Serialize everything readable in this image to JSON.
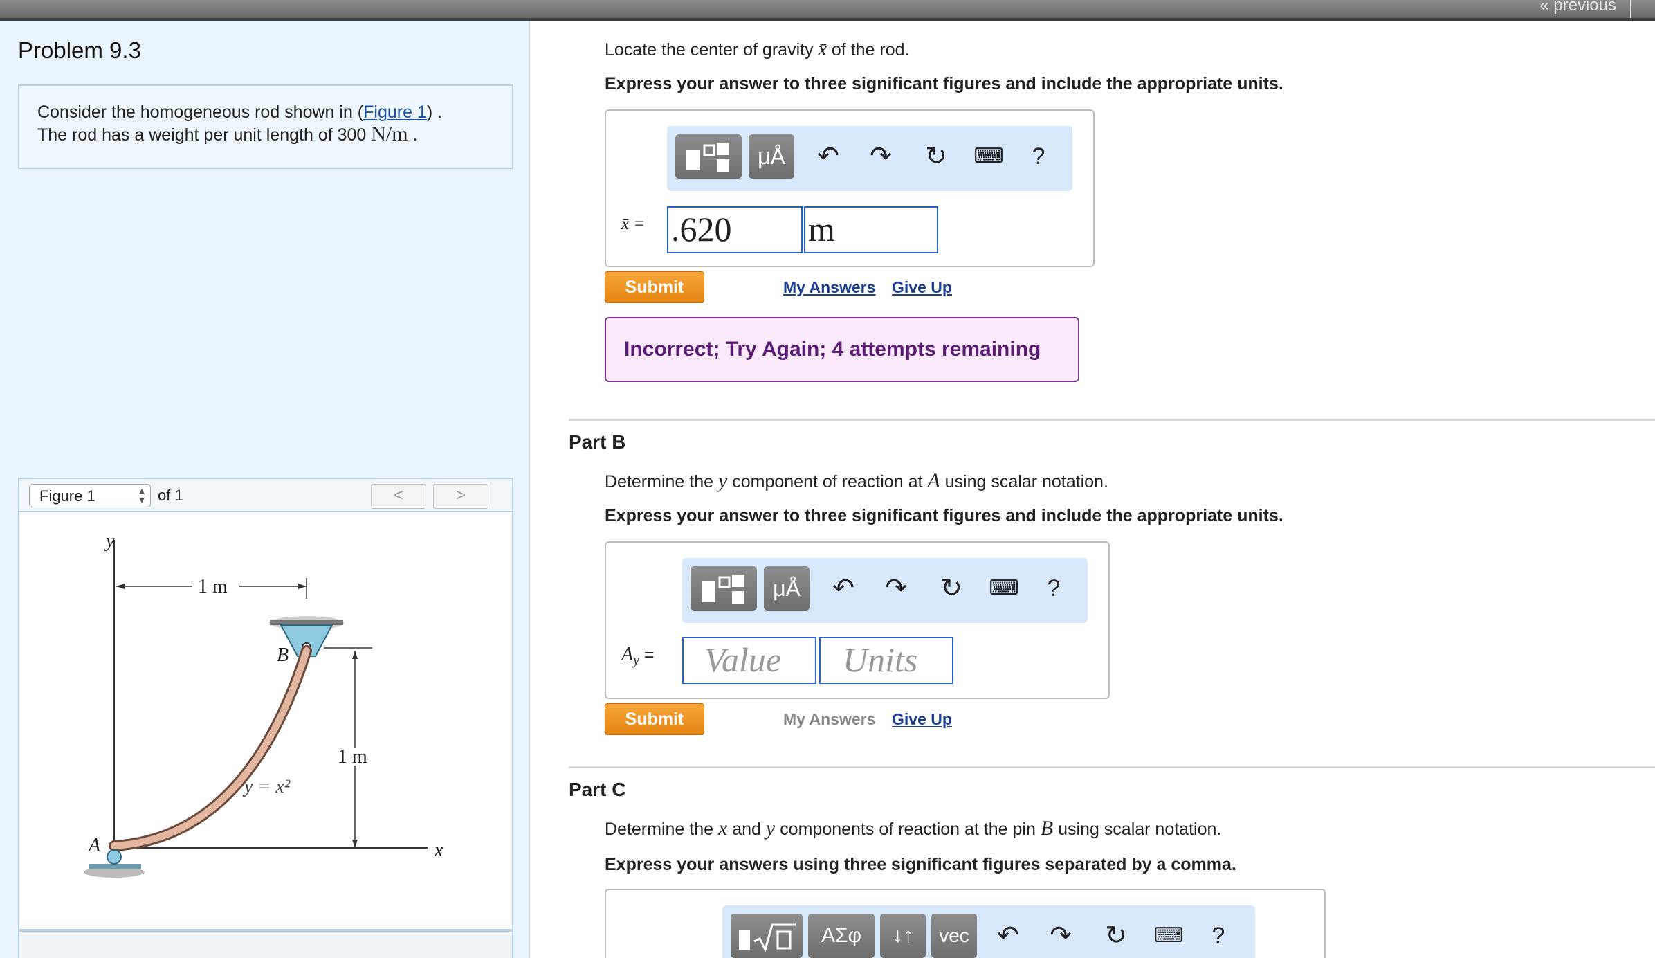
{
  "topbar": {
    "previous_label": "« previous"
  },
  "problem": {
    "title": "Problem 9.3",
    "intro_line1_prefix": "Consider the homogeneous rod shown in (",
    "intro_figure_link": "Figure 1",
    "intro_line1_suffix": ") .",
    "intro_line2_prefix": "The rod has a weight per unit length of 300 ",
    "intro_unit": "N/m",
    "intro_line2_suffix": " ."
  },
  "figure": {
    "select_value": "Figure 1",
    "of_label": "of 1",
    "prev_label": "<",
    "next_label": ">",
    "labels": {
      "y_axis": "y",
      "x_axis": "x",
      "span": "1 m",
      "height": "1 m",
      "point_a": "A",
      "point_b": "B",
      "curve": "y = x²"
    }
  },
  "partA": {
    "prompt_prefix": "Locate the center of gravity ",
    "prompt_var": "x̄",
    "prompt_suffix": " of the rod.",
    "instructions": "Express your answer to three significant figures and include the appropriate units.",
    "var_label": "x̄ =",
    "value": ".620",
    "units": "m",
    "submit_label": "Submit",
    "my_answers_label": "My Answers",
    "give_up_label": "Give Up",
    "feedback": "Incorrect; Try Again; 4 attempts remaining",
    "toolbar": {
      "mu_label": "μÅ",
      "help_label": "?"
    }
  },
  "partB": {
    "title": "Part B",
    "prompt_prefix": "Determine the ",
    "prompt_var1": "y",
    "prompt_mid": " component of reaction at ",
    "prompt_var2": "A",
    "prompt_suffix": " using scalar notation.",
    "instructions": "Express your answer to three significant figures and include the appropriate units.",
    "var_label": "A",
    "var_sub": "y",
    "var_eq": " =",
    "value_placeholder": "Value",
    "units_placeholder": "Units",
    "submit_label": "Submit",
    "my_answers_label": "My Answers",
    "give_up_label": "Give Up",
    "toolbar": {
      "mu_label": "μÅ",
      "help_label": "?"
    }
  },
  "partC": {
    "title": "Part C",
    "prompt_prefix": "Determine the ",
    "prompt_var1": "x",
    "prompt_and": " and ",
    "prompt_var2": "y",
    "prompt_mid": " components of reaction at the pin ",
    "prompt_var3": "B",
    "prompt_suffix": " using scalar notation.",
    "instructions": "Express your answers using three significant figures separated by a comma.",
    "toolbar": {
      "sigma_label": "ΑΣφ",
      "arrows_label": "↓↑",
      "vec_label": "vec",
      "help_label": "?"
    }
  },
  "colors": {
    "accent_orange": "#e48511",
    "link_blue": "#1a3f93",
    "feedback_purple": "#5a1d73",
    "field_blue": "#2c5fc2",
    "toolbar_bg": "#d7e8fb"
  }
}
